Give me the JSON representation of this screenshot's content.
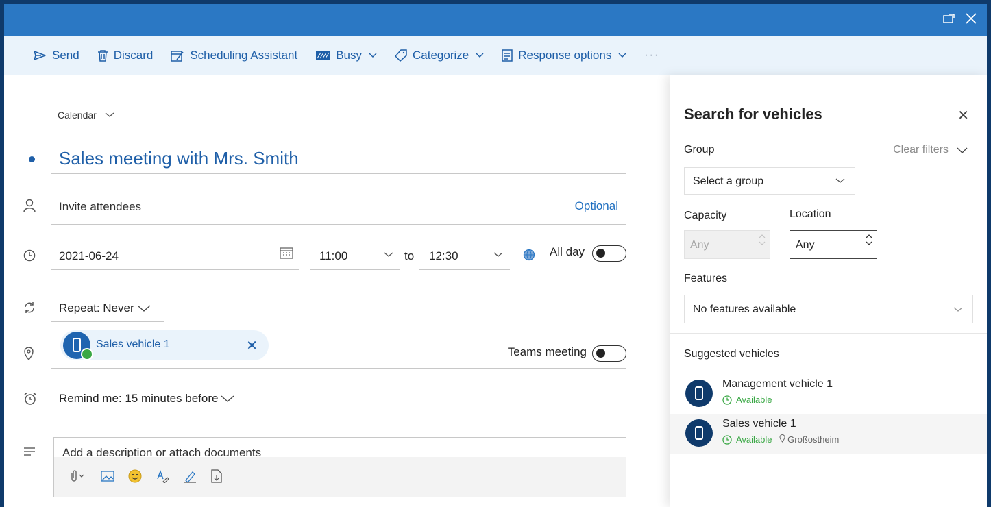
{
  "toolbar": {
    "send": "Send",
    "discard": "Discard",
    "scheduling": "Scheduling Assistant",
    "busy": "Busy",
    "categorize": "Categorize",
    "response": "Response options",
    "more": "···"
  },
  "form": {
    "calendar": "Calendar",
    "title": "Sales meeting with Mrs. Smith",
    "attendees_placeholder": "Invite attendees",
    "optional": "Optional",
    "date": "2021-06-24",
    "start_time": "11:00",
    "to": "to",
    "end_time": "12:30",
    "all_day": "All day",
    "repeat": "Repeat: Never",
    "location_chip": "Sales vehicle 1",
    "teams": "Teams meeting",
    "remind": "Remind me: 15 minutes before",
    "description_placeholder": "Add a description or attach documents"
  },
  "panel": {
    "title": "Search for vehicles",
    "group_label": "Group",
    "clear_filters": "Clear filters",
    "group_placeholder": "Select a group",
    "capacity_label": "Capacity",
    "location_label": "Location",
    "capacity_value": "Any",
    "location_value": "Any",
    "features_label": "Features",
    "features_value": "No features available",
    "suggested_label": "Suggested vehicles",
    "vehicles": [
      {
        "name": "Management vehicle 1",
        "status": "Available",
        "location": ""
      },
      {
        "name": "Sales vehicle 1",
        "status": "Available",
        "location": "Großostheim"
      }
    ]
  },
  "colors": {
    "accent": "#2b78c4",
    "link": "#1f5fa8",
    "available": "#3aa845",
    "frame": "#0f3a6b"
  }
}
